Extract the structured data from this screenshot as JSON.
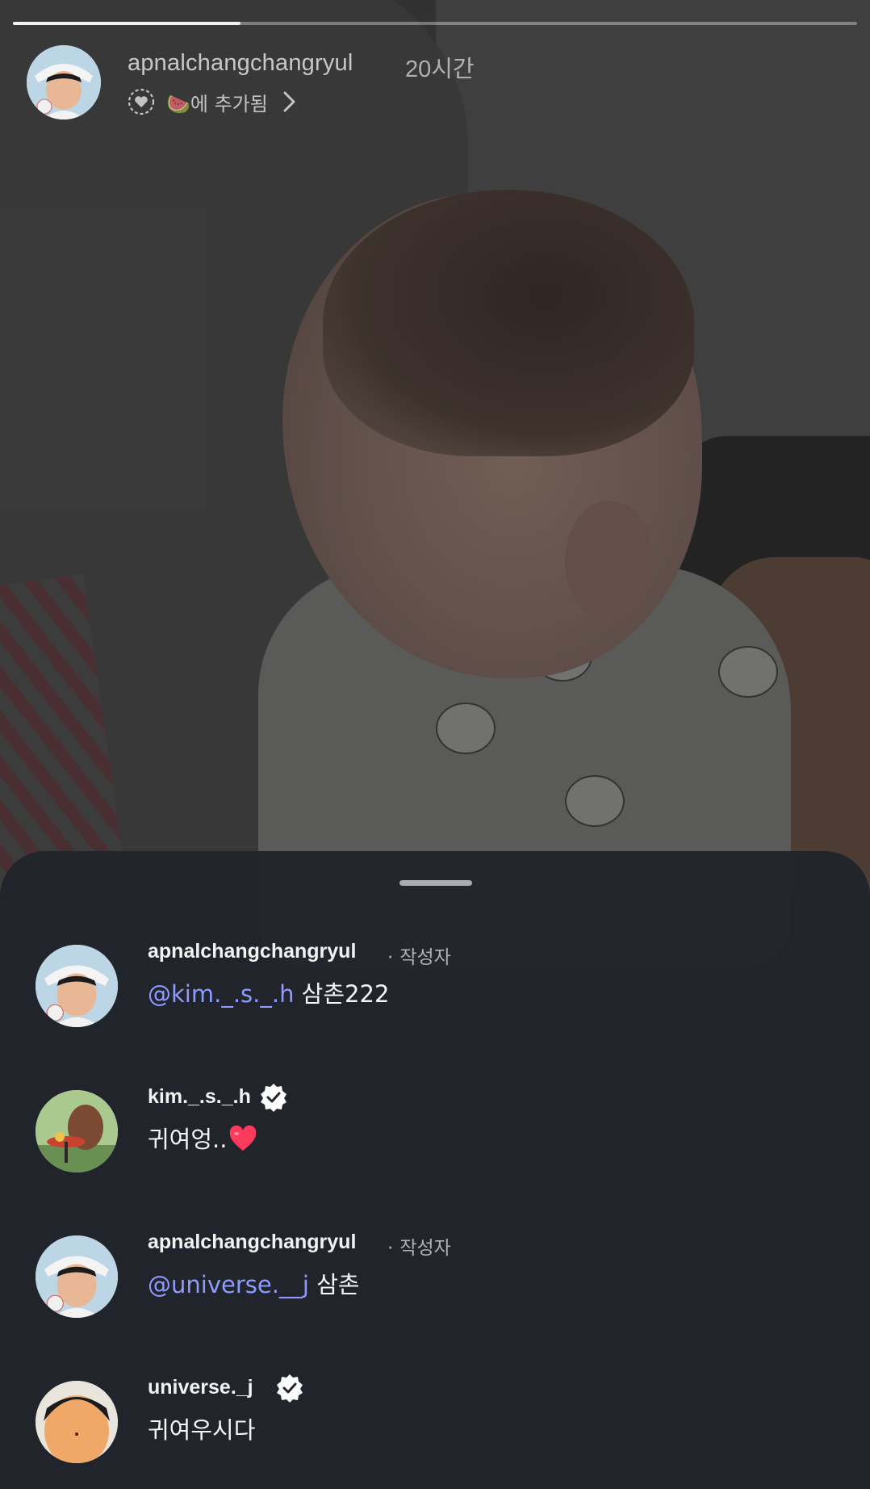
{
  "story": {
    "progress": 0.27,
    "username": "apnalchangchangryul",
    "time": "20시간",
    "added_text": "🍉에 추가됨"
  },
  "comments": [
    {
      "username": "apnalchangchangryul",
      "author_badge": "작성자",
      "author_sep": "·",
      "verified": false,
      "mention": "@kim._.s._.h",
      "text": " 삼촌222"
    },
    {
      "username": "kim._.s._.h",
      "verified": true,
      "mention": "",
      "text": "귀여엉.."
    },
    {
      "username": "apnalchangchangryul",
      "author_badge": "작성자",
      "author_sep": "·",
      "verified": false,
      "mention": "@universe.__j",
      "text": " 삼촌"
    },
    {
      "username": "universe._j",
      "verified": true,
      "mention": "",
      "text": "귀여우시다"
    }
  ],
  "colors": {
    "sheet": "#21252b",
    "mention": "#8d9aff",
    "verified": "#ffffff"
  }
}
